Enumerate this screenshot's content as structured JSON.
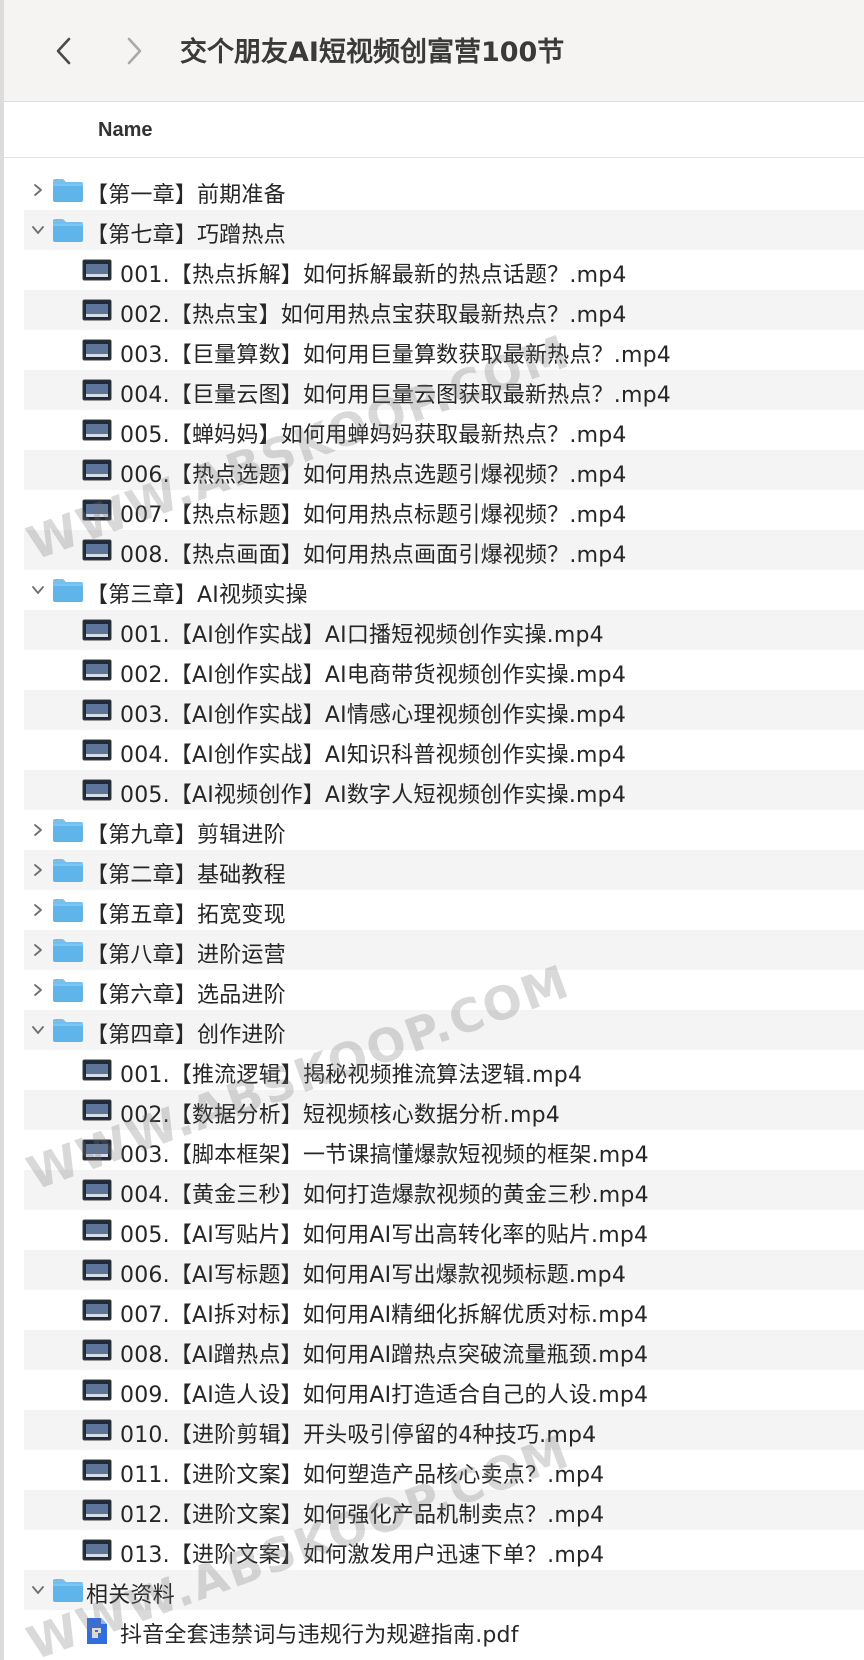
{
  "window": {
    "title": "交个朋友AI短视频创富营100节"
  },
  "table": {
    "columns": [
      "Name"
    ]
  },
  "rows": [
    {
      "kind": "folder",
      "level": 0,
      "expanded": false,
      "label": "【第一章】前期准备"
    },
    {
      "kind": "folder",
      "level": 0,
      "expanded": true,
      "label": "【第七章】巧蹭热点"
    },
    {
      "kind": "video",
      "level": 1,
      "label": "001.【热点拆解】如何拆解最新的热点话题？.mp4"
    },
    {
      "kind": "video",
      "level": 1,
      "label": "002.【热点宝】如何用热点宝获取最新热点？.mp4"
    },
    {
      "kind": "video",
      "level": 1,
      "label": "003.【巨量算数】如何用巨量算数获取最新热点？.mp4"
    },
    {
      "kind": "video",
      "level": 1,
      "label": "004.【巨量云图】如何用巨量云图获取最新热点？.mp4"
    },
    {
      "kind": "video",
      "level": 1,
      "label": "005.【蝉妈妈】如何用蝉妈妈获取最新热点？.mp4"
    },
    {
      "kind": "video",
      "level": 1,
      "label": "006.【热点选题】如何用热点选题引爆视频？.mp4"
    },
    {
      "kind": "video",
      "level": 1,
      "label": "007.【热点标题】如何用热点标题引爆视频？.mp4"
    },
    {
      "kind": "video",
      "level": 1,
      "label": "008.【热点画面】如何用热点画面引爆视频？.mp4"
    },
    {
      "kind": "folder",
      "level": 0,
      "expanded": true,
      "label": "【第三章】AI视频实操"
    },
    {
      "kind": "video",
      "level": 1,
      "label": "001.【AI创作实战】AI口播短视频创作实操.mp4"
    },
    {
      "kind": "video",
      "level": 1,
      "label": "002.【AI创作实战】AI电商带货视频创作实操.mp4"
    },
    {
      "kind": "video",
      "level": 1,
      "label": "003.【AI创作实战】AI情感心理视频创作实操.mp4"
    },
    {
      "kind": "video",
      "level": 1,
      "label": "004.【AI创作实战】AI知识科普视频创作实操.mp4"
    },
    {
      "kind": "video",
      "level": 1,
      "label": "005.【AI视频创作】AI数字人短视频创作实操.mp4"
    },
    {
      "kind": "folder",
      "level": 0,
      "expanded": false,
      "label": "【第九章】剪辑进阶"
    },
    {
      "kind": "folder",
      "level": 0,
      "expanded": false,
      "label": "【第二章】基础教程"
    },
    {
      "kind": "folder",
      "level": 0,
      "expanded": false,
      "label": "【第五章】拓宽变现"
    },
    {
      "kind": "folder",
      "level": 0,
      "expanded": false,
      "label": "【第八章】进阶运营"
    },
    {
      "kind": "folder",
      "level": 0,
      "expanded": false,
      "label": "【第六章】选品进阶"
    },
    {
      "kind": "folder",
      "level": 0,
      "expanded": true,
      "label": "【第四章】创作进阶"
    },
    {
      "kind": "video",
      "level": 1,
      "label": "001.【推流逻辑】揭秘视频推流算法逻辑.mp4"
    },
    {
      "kind": "video",
      "level": 1,
      "label": "002.【数据分析】短视频核心数据分析.mp4"
    },
    {
      "kind": "video",
      "level": 1,
      "label": "003.【脚本框架】一节课搞懂爆款短视频的框架.mp4"
    },
    {
      "kind": "video",
      "level": 1,
      "label": "004.【黄金三秒】如何打造爆款视频的黄金三秒.mp4"
    },
    {
      "kind": "video",
      "level": 1,
      "label": "005.【AI写贴片】如何用AI写出高转化率的贴片.mp4"
    },
    {
      "kind": "video",
      "level": 1,
      "label": "006.【AI写标题】如何用AI写出爆款视频标题.mp4"
    },
    {
      "kind": "video",
      "level": 1,
      "label": "007.【AI拆对标】如何用AI精细化拆解优质对标.mp4"
    },
    {
      "kind": "video",
      "level": 1,
      "label": "008.【AI蹭热点】如何用AI蹭热点突破流量瓶颈.mp4"
    },
    {
      "kind": "video",
      "level": 1,
      "label": "009.【AI造人设】如何用AI打造适合自己的人设.mp4"
    },
    {
      "kind": "video",
      "level": 1,
      "label": "010.【进阶剪辑】开头吸引停留的4种技巧.mp4"
    },
    {
      "kind": "video",
      "level": 1,
      "label": "011.【进阶文案】如何塑造产品核心卖点？.mp4"
    },
    {
      "kind": "video",
      "level": 1,
      "label": "012.【进阶文案】如何强化产品机制卖点？.mp4"
    },
    {
      "kind": "video",
      "level": 1,
      "label": "013.【进阶文案】如何激发用户迅速下单？.mp4"
    },
    {
      "kind": "folder",
      "level": 0,
      "expanded": true,
      "label": "相关资料"
    },
    {
      "kind": "pdf",
      "level": 1,
      "label": "抖音全套违禁词与违规行为规避指南.pdf"
    }
  ],
  "watermark": {
    "text": "WWW.ABSKOOP.COM"
  },
  "colors": {
    "folder_blue": "#5fb4ea",
    "pdf_blue": "#2f6de1",
    "row_stripe": "#f4f4f4",
    "titlebar_bg": "#f6f4f2"
  }
}
